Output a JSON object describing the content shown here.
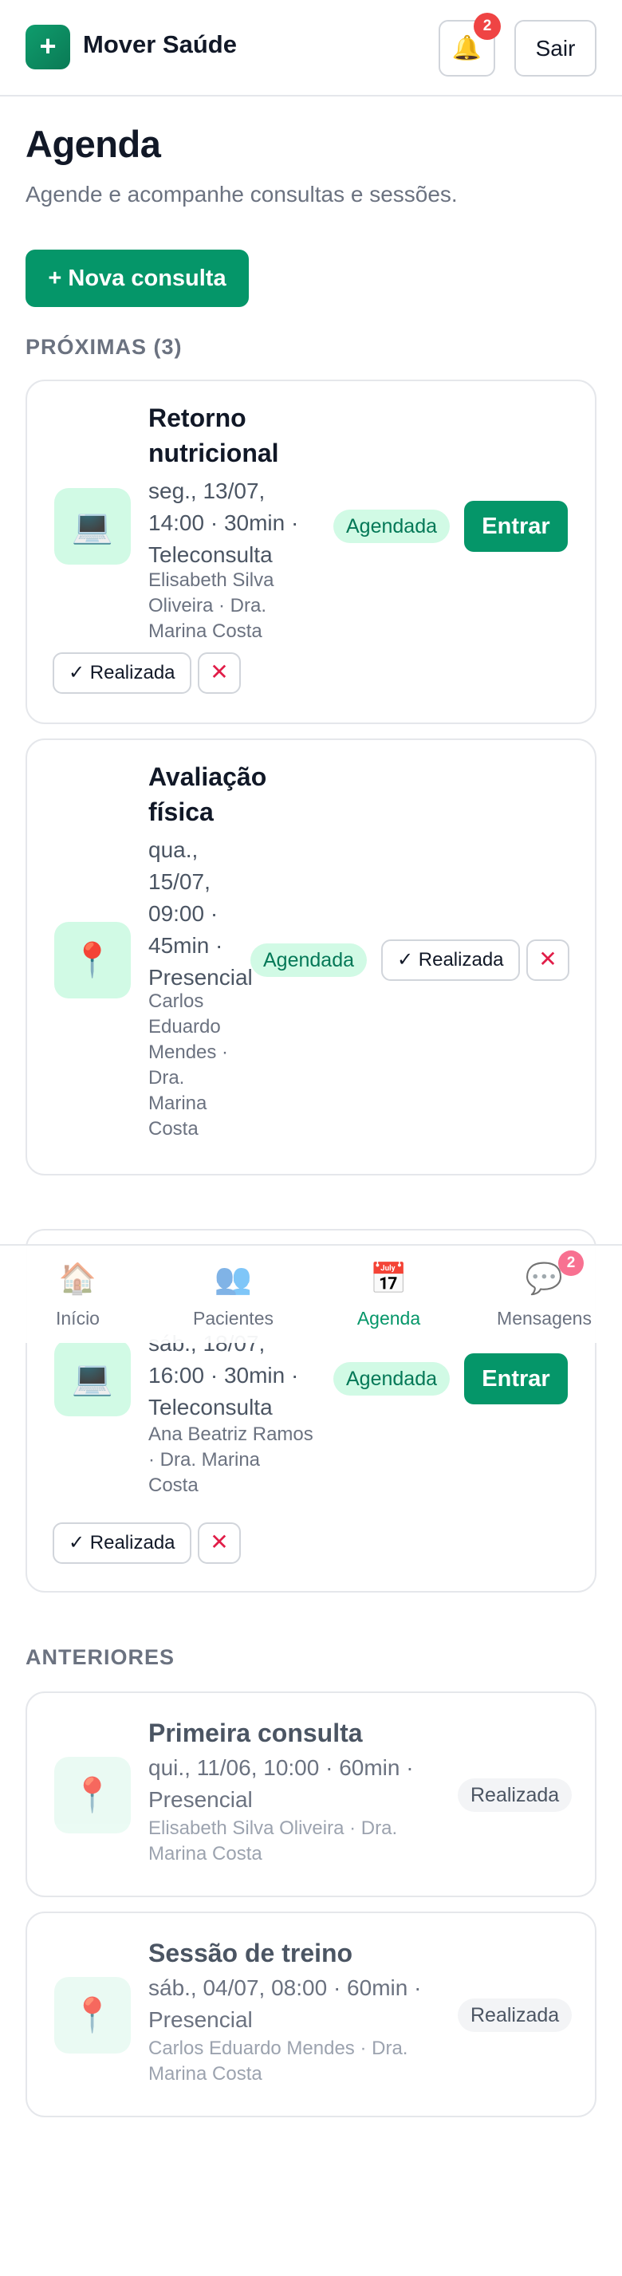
{
  "header": {
    "logo_symbol": "+",
    "app_name": "Mover Saúde",
    "notifications_count": "2",
    "bell_icon": "bell-icon",
    "logout_label": "Sair"
  },
  "page": {
    "title": "Agenda",
    "subtitle": "Agende e acompanhe consultas e sessões.",
    "new_button": "+ Nova consulta"
  },
  "upcoming": {
    "label": "PRÓXIMAS (3)",
    "items": [
      {
        "icon": "laptop-icon",
        "title_lines": [
          "Retorno",
          "nutricional"
        ],
        "meta_lines": [
          "seg., 13/07,",
          "14:00 · 30min ·",
          "Teleconsulta"
        ],
        "people_lines": [
          "Elisabeth Silva",
          "Oliveira · Dra.",
          "Marina Costa"
        ],
        "status": "Agendada",
        "enter_label": "Entrar",
        "done_label": "✓ Realizada",
        "cancel_symbol": "✕"
      },
      {
        "icon": "pin-icon",
        "title_lines": [
          "Avaliação",
          "física"
        ],
        "meta_lines": [
          "qua.,",
          "15/07,",
          "09:00 ·",
          "45min ·",
          "Presencial"
        ],
        "people_lines": [
          "Carlos",
          "Eduardo",
          "Mendes ·",
          "Dra.",
          "Marina",
          "Costa"
        ],
        "status": "Agendada",
        "done_label": "✓ Realizada",
        "cancel_symbol": "✕"
      },
      {
        "icon": "laptop-icon",
        "meta_lines": [
          "sáb., 18/07,",
          "16:00 · 30min ·",
          "Teleconsulta"
        ],
        "people_lines": [
          "Ana Beatriz Ramos",
          "· Dra. Marina",
          "Costa"
        ],
        "status": "Agendada",
        "enter_label": "Entrar",
        "done_label": "✓ Realizada",
        "cancel_symbol": "✕"
      }
    ]
  },
  "past": {
    "label": "ANTERIORES",
    "items": [
      {
        "icon": "pin-icon",
        "title": "Primeira consulta",
        "meta_lines": [
          "qui., 11/06, 10:00 · 60min ·",
          "Presencial"
        ],
        "people_lines": [
          "Elisabeth Silva Oliveira · Dra.",
          "Marina Costa"
        ],
        "status": "Realizada"
      },
      {
        "icon": "pin-icon",
        "title": "Sessão de treino",
        "meta_lines": [
          "sáb., 04/07, 08:00 · 60min ·",
          "Presencial"
        ],
        "people_lines": [
          "Carlos Eduardo Mendes · Dra.",
          "Marina Costa"
        ],
        "status": "Realizada"
      }
    ]
  },
  "nav": {
    "items": [
      {
        "label": "Início",
        "icon": "home-icon"
      },
      {
        "label": "Pacientes",
        "icon": "patients-icon"
      },
      {
        "label": "Agenda",
        "icon": "calendar-icon",
        "active": true
      },
      {
        "label": "Mensagens",
        "icon": "messages-icon"
      }
    ],
    "messages_badge": "2"
  },
  "colors": {
    "brand": "#059669",
    "status_bg": "#d1fae5",
    "status_text": "#047857",
    "badge": "#ef4444",
    "cancel": "#e11d48"
  }
}
